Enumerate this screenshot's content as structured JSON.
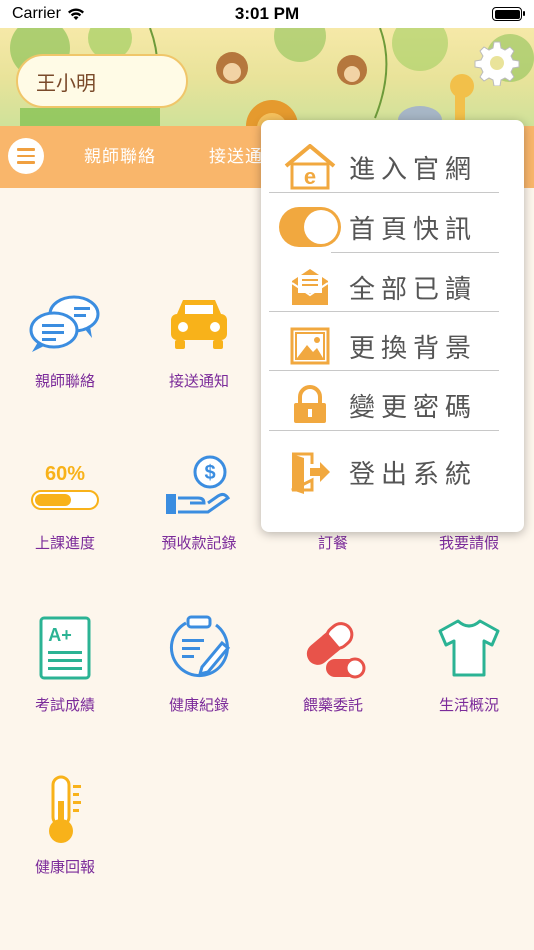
{
  "status_bar": {
    "carrier": "Carrier",
    "time": "3:01 PM"
  },
  "header": {
    "user_name": "王小明"
  },
  "tabs": [
    "親師聯絡",
    "接送通"
  ],
  "grid": [
    {
      "label": "親師聯絡",
      "icon": "chat-bubbles-icon"
    },
    {
      "label": "接送通知",
      "icon": "car-icon"
    },
    {
      "label": "上課進度",
      "icon": "progress-bar-icon",
      "progress_text": "60%",
      "progress": 0.6
    },
    {
      "label": "預收款記錄",
      "icon": "money-hand-icon"
    },
    {
      "label": "訂餐",
      "icon": "meal-icon"
    },
    {
      "label": "我要請假",
      "icon": "leave-icon"
    },
    {
      "label": "考試成績",
      "icon": "exam-paper-icon",
      "grade": "A+"
    },
    {
      "label": "健康紀錄",
      "icon": "clipboard-pencil-icon"
    },
    {
      "label": "餵藥委託",
      "icon": "pill-capsule-icon"
    },
    {
      "label": "生活概況",
      "icon": "tshirt-icon"
    },
    {
      "label": "健康回報",
      "icon": "thermometer-icon"
    }
  ],
  "dropdown": {
    "items": [
      {
        "label": "進入官網",
        "icon": "house-e-icon"
      },
      {
        "label": "首頁快訊",
        "icon": "toggle-switch",
        "toggle_on": true
      },
      {
        "label": "全部已讀",
        "icon": "envelope-icon"
      },
      {
        "label": "更換背景",
        "icon": "picture-icon"
      },
      {
        "label": "變更密碼",
        "icon": "lock-icon"
      },
      {
        "label": "登出系統",
        "icon": "logout-door-icon"
      }
    ]
  },
  "colors": {
    "accent_orange": "#f1a83f",
    "label_purple": "#7b2b9a",
    "tab_orange": "#f9b66b",
    "icon_blue": "#3b8de0",
    "icon_red": "#e8534a",
    "icon_green": "#2bb394"
  }
}
